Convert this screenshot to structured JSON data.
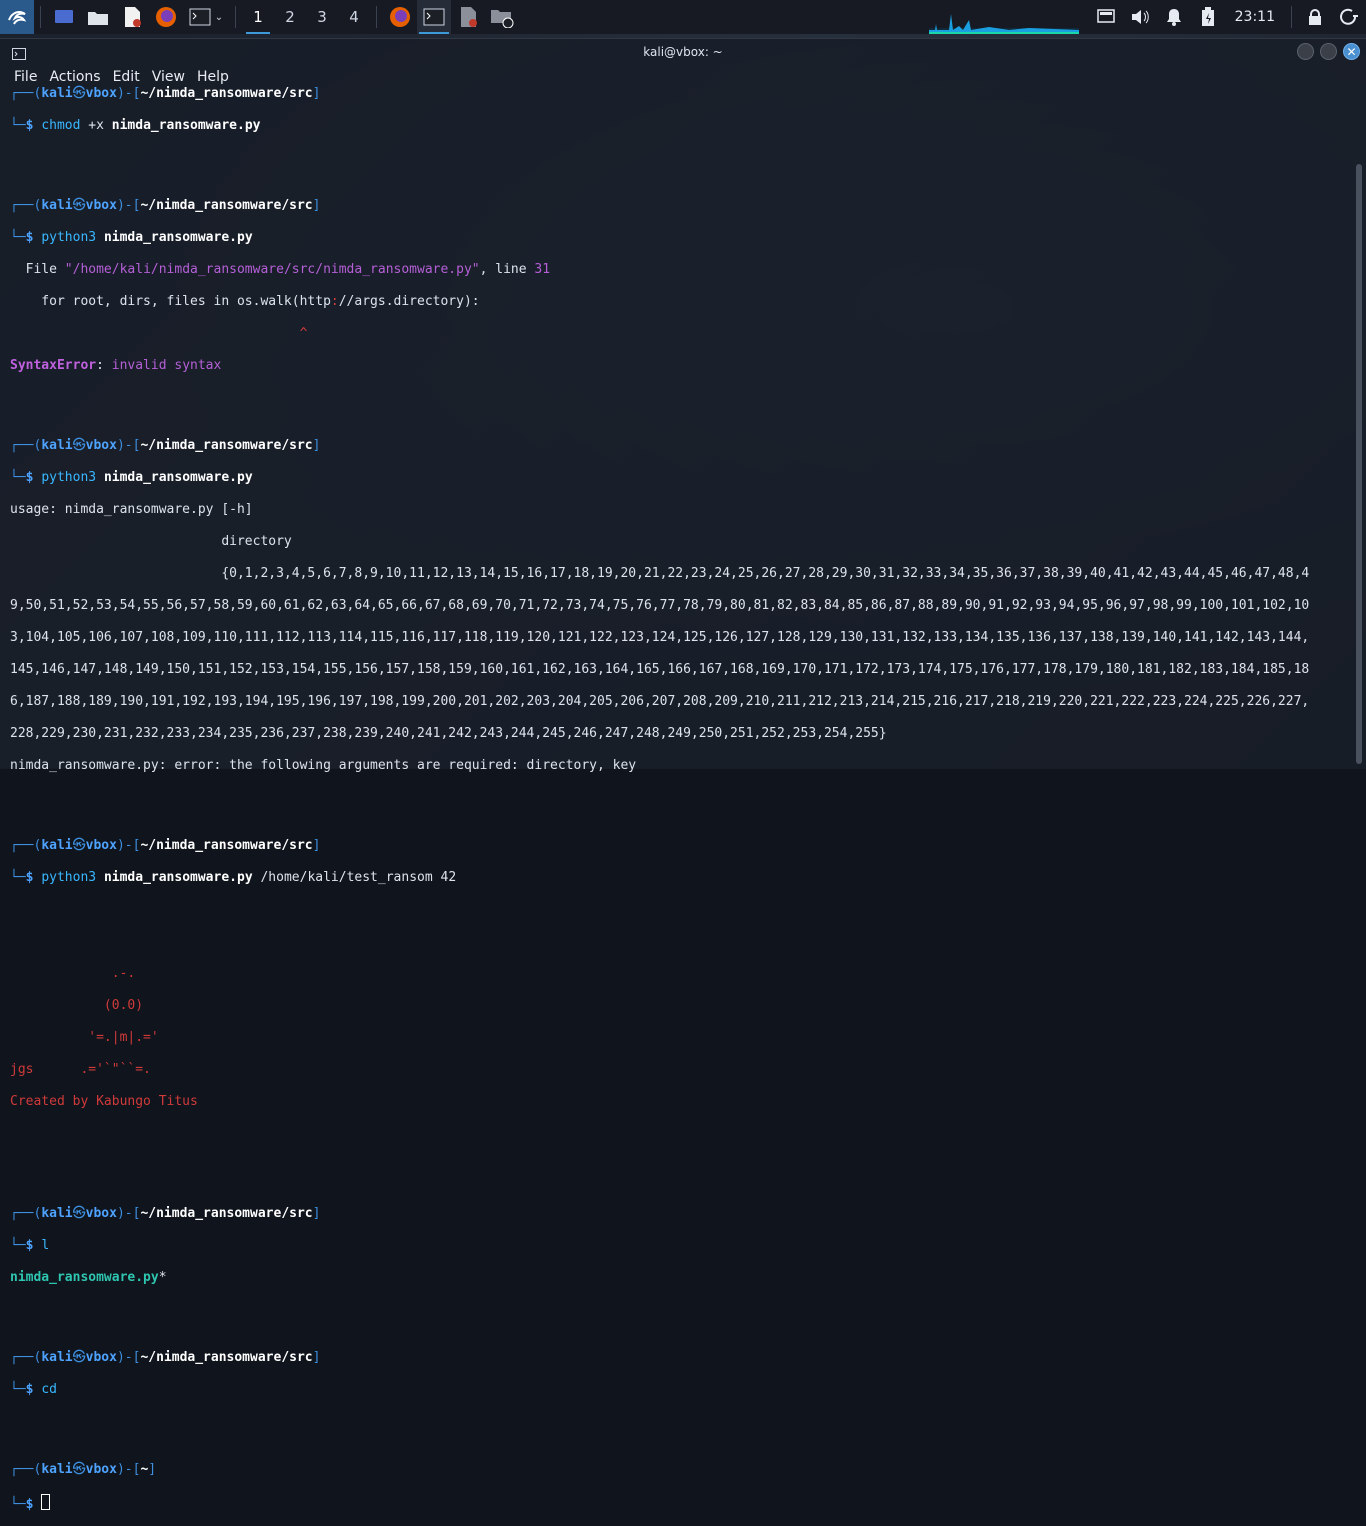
{
  "taskbar": {
    "workspaces": [
      "1",
      "2",
      "3",
      "4"
    ],
    "active_workspace": "1",
    "clock": "23:11"
  },
  "window": {
    "title": "kali@vbox: ~",
    "menu": [
      "File",
      "Actions",
      "Edit",
      "View",
      "Help"
    ]
  },
  "terminal": {
    "user": "kali",
    "at": "㉿",
    "host": "vbox",
    "path_src": "~/nimda_ransomware/src",
    "path_home": "~",
    "prompt_sym": "$",
    "cmd1_a": "chmod",
    "cmd1_b": " +x ",
    "cmd1_c": "nimda_ransomware.py",
    "cmd2_a": "python3",
    "cmd2_b": " ",
    "cmd2_c": "nimda_ransomware.py",
    "tb_line1_a": "  File ",
    "tb_line1_b": "\"/home/kali/nimda_ransomware/src/nimda_ransomware.py\"",
    "tb_line1_c": ", line ",
    "tb_line1_d": "31",
    "tb_line2_a": "    for root, dirs, files in os.walk(http",
    "tb_line2_b": ":",
    "tb_line2_c": "//args.directory):",
    "tb_caret": "                                     ^",
    "err_a": "SyntaxError",
    "err_b": ": ",
    "err_c": "invalid syntax",
    "usage1": "usage: nimda_ransomware.py [-h]",
    "usage2": "                           directory",
    "usage3": "                           {0,1,2,3,4,5,6,7,8,9,10,11,12,13,14,15,16,17,18,19,20,21,22,23,24,25,26,27,28,29,30,31,32,33,34,35,36,37,38,39,40,41,42,43,44,45,46,47,48,4",
    "usage4": "9,50,51,52,53,54,55,56,57,58,59,60,61,62,63,64,65,66,67,68,69,70,71,72,73,74,75,76,77,78,79,80,81,82,83,84,85,86,87,88,89,90,91,92,93,94,95,96,97,98,99,100,101,102,10",
    "usage5": "3,104,105,106,107,108,109,110,111,112,113,114,115,116,117,118,119,120,121,122,123,124,125,126,127,128,129,130,131,132,133,134,135,136,137,138,139,140,141,142,143,144,",
    "usage6": "145,146,147,148,149,150,151,152,153,154,155,156,157,158,159,160,161,162,163,164,165,166,167,168,169,170,171,172,173,174,175,176,177,178,179,180,181,182,183,184,185,18",
    "usage7": "6,187,188,189,190,191,192,193,194,195,196,197,198,199,200,201,202,203,204,205,206,207,208,209,210,211,212,213,214,215,216,217,218,219,220,221,222,223,224,225,226,227,",
    "usage8": "228,229,230,231,232,233,234,235,236,237,238,239,240,241,242,243,244,245,246,247,248,249,250,251,252,253,254,255}",
    "usage_err": "nimda_ransomware.py: error: the following arguments are required: directory, key",
    "cmd4_d": " /home/kali/test_ransom 42",
    "art1": "             .-.",
    "art2": "            (0.0)",
    "art3": "          '=.|m|.='",
    "art4": "jgs      .='`\"``=.",
    "art5": "Created by Kabungo Titus",
    "cmd5": "l",
    "ls_out": "nimda_ransomware.py",
    "ls_star": "*",
    "cmd6": "cd"
  }
}
